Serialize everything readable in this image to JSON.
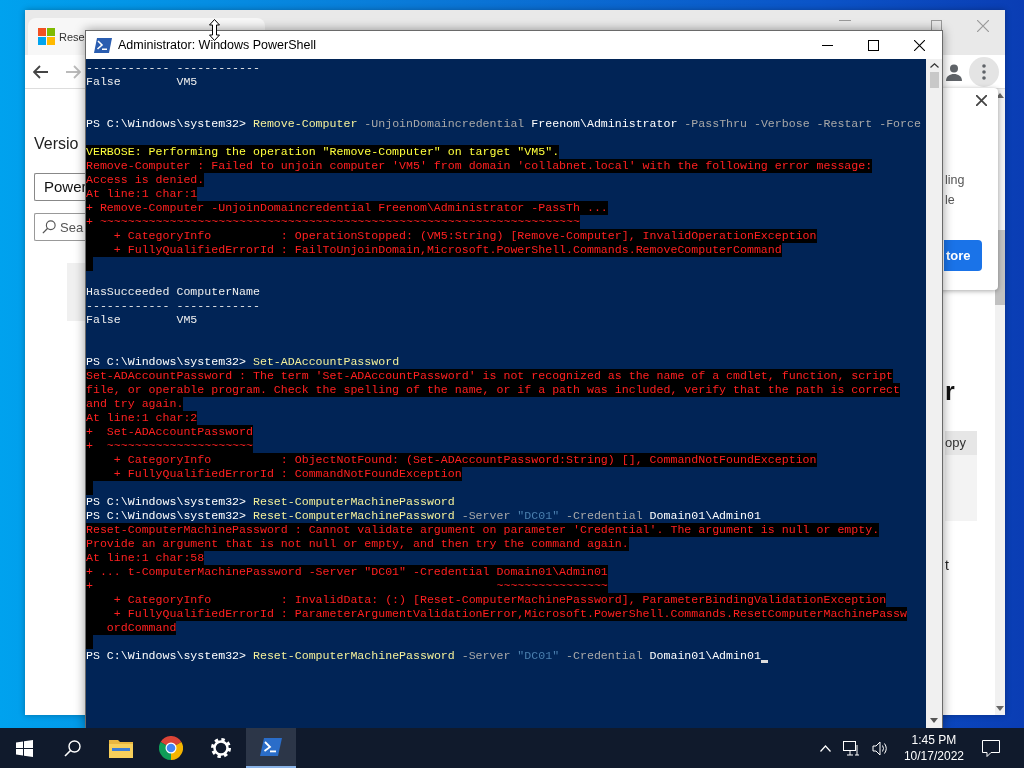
{
  "browser": {
    "tab_title": "Rese",
    "heading": "Versio",
    "field_value": "Power",
    "search_placeholder": "Sea",
    "popup": {
      "lines": [
        "ling",
        "le"
      ],
      "button": "tore"
    },
    "right_heading": "r",
    "copy_button": "opy",
    "right_text": "t"
  },
  "powershell": {
    "title": "Administrator: Windows PowerShell",
    "lines": [
      {
        "kind": "output",
        "text": "------------ ------------"
      },
      {
        "kind": "output",
        "text": "False        VM5"
      },
      {
        "kind": "blank"
      },
      {
        "kind": "blank"
      },
      {
        "kind": "command",
        "segments": [
          {
            "kind": "prompt",
            "text": "PS C:\\Windows\\system32>"
          },
          {
            "kind": "command",
            "text": "Remove-Computer"
          },
          {
            "kind": "parameter",
            "text": "-UnjoinDomaincredential"
          },
          {
            "kind": "argument",
            "text": "Freenom\\Administrator"
          },
          {
            "kind": "parameter",
            "text": "-PassThru"
          },
          {
            "kind": "parameter",
            "text": "-Verbose"
          },
          {
            "kind": "parameter",
            "text": "-Restart"
          },
          {
            "kind": "parameter",
            "text": "-Force"
          }
        ]
      },
      {
        "kind": "blank"
      },
      {
        "kind": "verbose",
        "text": "VERBOSE: Performing the operation \"Remove-Computer\" on target \"VM5\"."
      },
      {
        "kind": "error",
        "text": "Remove-Computer : Failed to unjoin computer 'VM5' from domain 'collabnet.local' with the following error message:"
      },
      {
        "kind": "error",
        "text": "Access is denied."
      },
      {
        "kind": "error",
        "text": "At line:1 char:1"
      },
      {
        "kind": "error",
        "text": "+ Remove-Computer -UnjoinDomaincredential Freenom\\Administrator -PassTh ..."
      },
      {
        "kind": "error",
        "text": "+ ~~~~~~~~~~~~~~~~~~~~~~~~~~~~~~~~~~~~~~~~~~~~~~~~~~~~~~~~~~~~~~~~~~~~~"
      },
      {
        "kind": "error",
        "text": "    + CategoryInfo          : OperationStopped: (VM5:String) [Remove-Computer], InvalidOperationException"
      },
      {
        "kind": "error",
        "text": "    + FullyQualifiedErrorId : FailToUnjoinDomain,Microsoft.PowerShell.Commands.RemoveComputerCommand"
      },
      {
        "kind": "error_gap"
      },
      {
        "kind": "blank"
      },
      {
        "kind": "output",
        "text": "HasSucceeded ComputerName"
      },
      {
        "kind": "output",
        "text": "------------ ------------"
      },
      {
        "kind": "output",
        "text": "False        VM5"
      },
      {
        "kind": "blank"
      },
      {
        "kind": "blank"
      },
      {
        "kind": "command",
        "segments": [
          {
            "kind": "prompt",
            "text": "PS C:\\Windows\\system32>"
          },
          {
            "kind": "command",
            "text": "Set-ADAccountPassword"
          }
        ]
      },
      {
        "kind": "error",
        "text": "Set-ADAccountPassword : The term 'Set-ADAccountPassword' is not recognized as the name of a cmdlet, function, script"
      },
      {
        "kind": "error",
        "text": "file, or operable program. Check the spelling of the name, or if a path was included, verify that the path is correct"
      },
      {
        "kind": "error",
        "text": "and try again."
      },
      {
        "kind": "error",
        "text": "At line:1 char:2"
      },
      {
        "kind": "error",
        "text": "+  Set-ADAccountPassword"
      },
      {
        "kind": "error",
        "text": "+  ~~~~~~~~~~~~~~~~~~~~~"
      },
      {
        "kind": "error",
        "text": "    + CategoryInfo          : ObjectNotFound: (Set-ADAccountPassword:String) [], CommandNotFoundException"
      },
      {
        "kind": "error",
        "text": "    + FullyQualifiedErrorId : CommandNotFoundException"
      },
      {
        "kind": "error_gap"
      },
      {
        "kind": "command",
        "segments": [
          {
            "kind": "prompt",
            "text": "PS C:\\Windows\\system32>"
          },
          {
            "kind": "command",
            "text": "Reset-ComputerMachinePassword"
          }
        ]
      },
      {
        "kind": "command",
        "segments": [
          {
            "kind": "prompt",
            "text": "PS C:\\Windows\\system32>"
          },
          {
            "kind": "command",
            "text": "Reset-ComputerMachinePassword"
          },
          {
            "kind": "parameter",
            "text": "-Server"
          },
          {
            "kind": "string",
            "text": "\"DC01\""
          },
          {
            "kind": "parameter",
            "text": "-Credential"
          },
          {
            "kind": "argument",
            "text": "Domain01\\Admin01"
          }
        ]
      },
      {
        "kind": "error",
        "text": "Reset-ComputerMachinePassword : Cannot validate argument on parameter 'Credential'. The argument is null or empty."
      },
      {
        "kind": "error",
        "text": "Provide an argument that is not null or empty, and then try the command again."
      },
      {
        "kind": "error",
        "text": "At line:1 char:58"
      },
      {
        "kind": "error",
        "text": "+ ... t-ComputerMachinePassword -Server \"DC01\" -Credential Domain01\\Admin01"
      },
      {
        "kind": "error",
        "text": "+                                                          ~~~~~~~~~~~~~~~~"
      },
      {
        "kind": "error",
        "text": "    + CategoryInfo          : InvalidData: (:) [Reset-ComputerMachinePassword], ParameterBindingValidationException"
      },
      {
        "kind": "error",
        "text": "    + FullyQualifiedErrorId : ParameterArgumentValidationError,Microsoft.PowerShell.Commands.ResetComputerMachinePassw"
      },
      {
        "kind": "error",
        "text": "   ordCommand"
      },
      {
        "kind": "error_gap"
      },
      {
        "kind": "command",
        "cursor": true,
        "segments": [
          {
            "kind": "prompt",
            "text": "PS C:\\Windows\\system32>"
          },
          {
            "kind": "command",
            "text": "Reset-ComputerMachinePassword"
          },
          {
            "kind": "parameter",
            "text": "-Server"
          },
          {
            "kind": "string",
            "text": "\"DC01\""
          },
          {
            "kind": "parameter",
            "text": "-Credential"
          },
          {
            "kind": "argument",
            "text": "Domain01\\Admin01"
          }
        ]
      }
    ]
  },
  "taskbar": {
    "apps": [
      {
        "kind": "explorer",
        "selected": false
      },
      {
        "kind": "browser",
        "selected": false
      },
      {
        "kind": "settings",
        "selected": false
      },
      {
        "kind": "terminal",
        "selected": true
      }
    ],
    "time": "1:45 PM",
    "date": "10/17/2022"
  }
}
